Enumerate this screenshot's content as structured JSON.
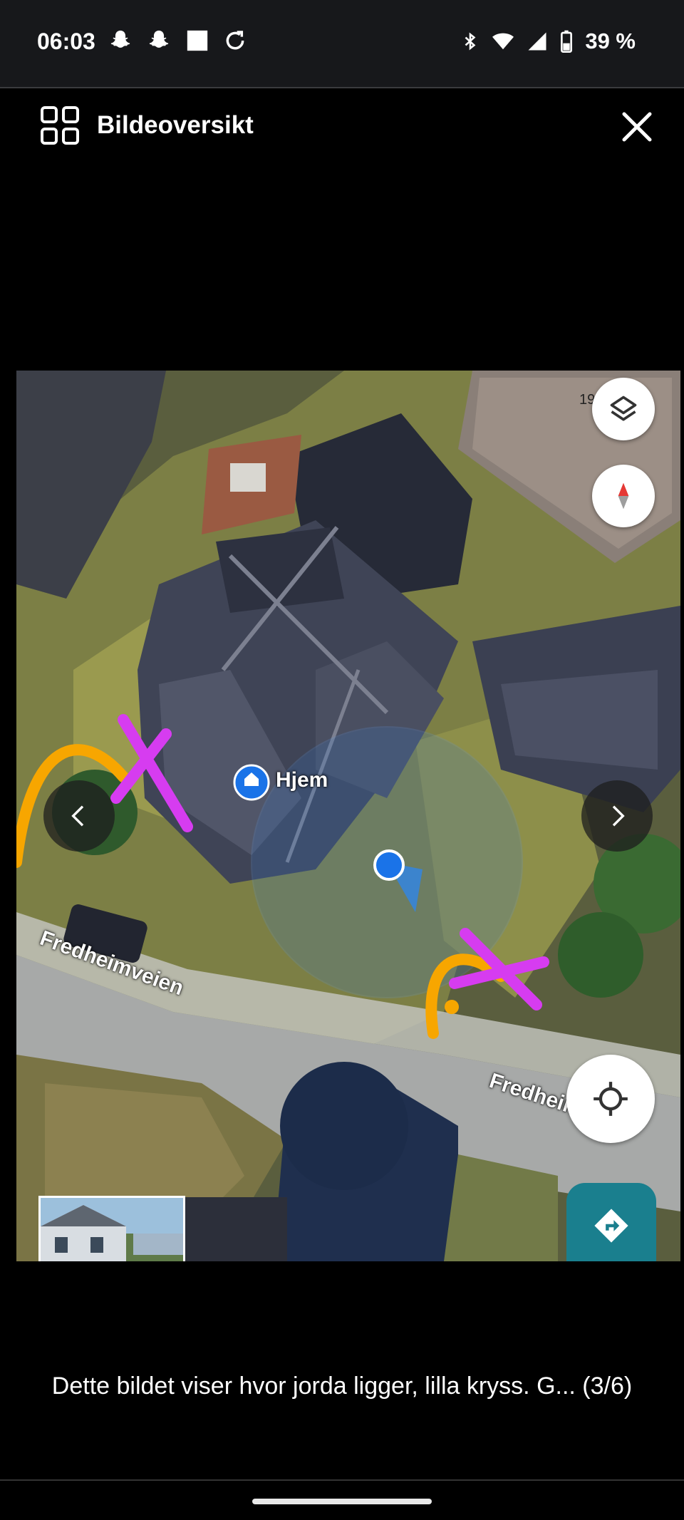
{
  "status_bar": {
    "time": "06:03",
    "battery": "39 %",
    "left_icons": [
      "snapchat-icon",
      "snapchat-icon",
      "square-icon",
      "sync-icon"
    ],
    "right_icons": [
      "bluetooth-icon",
      "wifi-icon",
      "signal-icon",
      "battery-icon"
    ]
  },
  "appbar": {
    "title": "Bildeoversikt",
    "overview_icon": "grid-icon",
    "close_icon": "close-icon"
  },
  "map": {
    "home_label": "Hjem",
    "street_1": "Fredheimveien",
    "street_2": "Fredheimveien",
    "corner_text": "19",
    "controls": [
      "layers-icon",
      "compass-icon",
      "my-location-icon",
      "directions-icon"
    ]
  },
  "navigation": {
    "prev_icon": "chevron-left-icon",
    "next_icon": "chevron-right-icon"
  },
  "caption": {
    "text": "Dette bildet viser hvor jorda ligger, lilla kryss. G... (3/6)"
  },
  "colors": {
    "accent_teal": "#1a7f8e",
    "marker_blue": "#1a73e8",
    "annotation_purple": "#d63cf0",
    "annotation_orange": "#f7a600"
  }
}
